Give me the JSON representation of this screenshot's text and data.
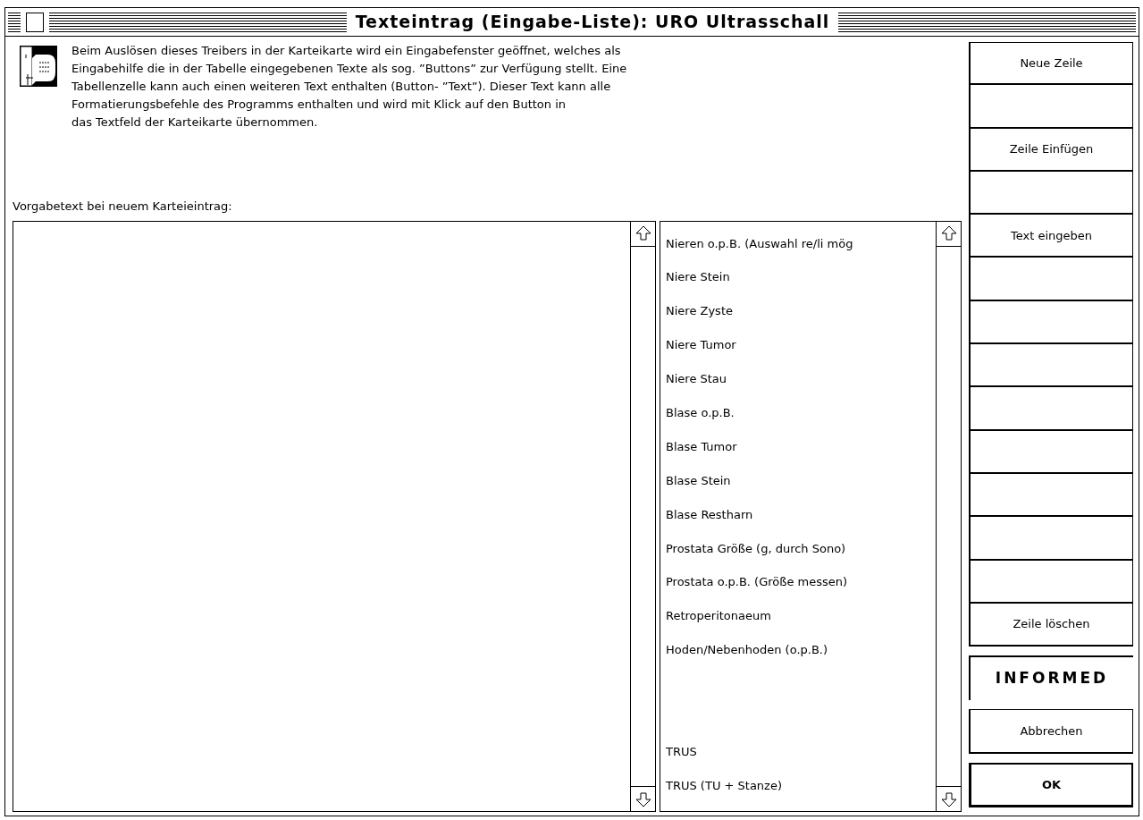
{
  "window": {
    "title": "Texteintrag (Eingabe-Liste): URO Ultrasschall"
  },
  "description": "Beim Auslösen dieses Treibers in der Karteikarte wird ein Eingabefenster geöffnet, welches als\nEingabehilfe die in der Tabelle eingegebenen Texte als sog. ”Buttons” zur Verfügung stellt. Eine\nTabellenzelle kann auch einen weiteren Text enthalten (Button- ”Text”). Dieser Text kann alle\nFormatierungsbefehle des Programms enthalten und wird mit Klick auf den Button in\ndas Textfeld der Karteikarte übernommen.",
  "default_text": {
    "label": "Vorgabetext bei neuem Karteieintrag:"
  },
  "entries": [
    {
      "kind": "text",
      "label": "Nieren o.p.B. (Auswahl re/li mög"
    },
    {
      "kind": "text",
      "label": "Niere Stein"
    },
    {
      "kind": "text",
      "label": "Niere Zyste"
    },
    {
      "kind": "text",
      "label": "Niere Tumor"
    },
    {
      "kind": "text",
      "label": "Niere Stau"
    },
    {
      "kind": "text",
      "label": "Blase o.p.B."
    },
    {
      "kind": "text",
      "label": "Blase Tumor"
    },
    {
      "kind": "text",
      "label": "Blase Stein"
    },
    {
      "kind": "text",
      "label": "Blase Restharn"
    },
    {
      "kind": "text",
      "label": "Prostata Größe (g, durch Sono)"
    },
    {
      "kind": "text",
      "label": "Prostata o.p.B. (Größe messen)"
    },
    {
      "kind": "text",
      "label": "Retroperitonaeum"
    },
    {
      "kind": "text",
      "label": "Hoden/Nebenhoden (o.p.B.)"
    },
    {
      "kind": "blank"
    },
    {
      "kind": "blank"
    },
    {
      "kind": "text",
      "label": "TRUS"
    },
    {
      "kind": "text",
      "label": "TRUS (TU + Stanze)"
    }
  ],
  "side_buttons": [
    {
      "kind": "text",
      "label": "Neue Zeile"
    },
    {
      "kind": "blank"
    },
    {
      "kind": "text",
      "label": "Zeile Einfügen"
    },
    {
      "kind": "blank"
    },
    {
      "kind": "text",
      "label": "Text eingeben"
    },
    {
      "kind": "blank"
    },
    {
      "kind": "blank"
    },
    {
      "kind": "blank"
    },
    {
      "kind": "blank"
    },
    {
      "kind": "blank"
    },
    {
      "kind": "blank"
    },
    {
      "kind": "blank"
    },
    {
      "kind": "blank"
    },
    {
      "kind": "text",
      "label": "Zeile löschen"
    }
  ],
  "logo": {
    "text": "INFORMED"
  },
  "dialog_buttons": [
    {
      "label": "Abbrechen",
      "default": false
    },
    {
      "label": "OK",
      "default": true
    }
  ]
}
